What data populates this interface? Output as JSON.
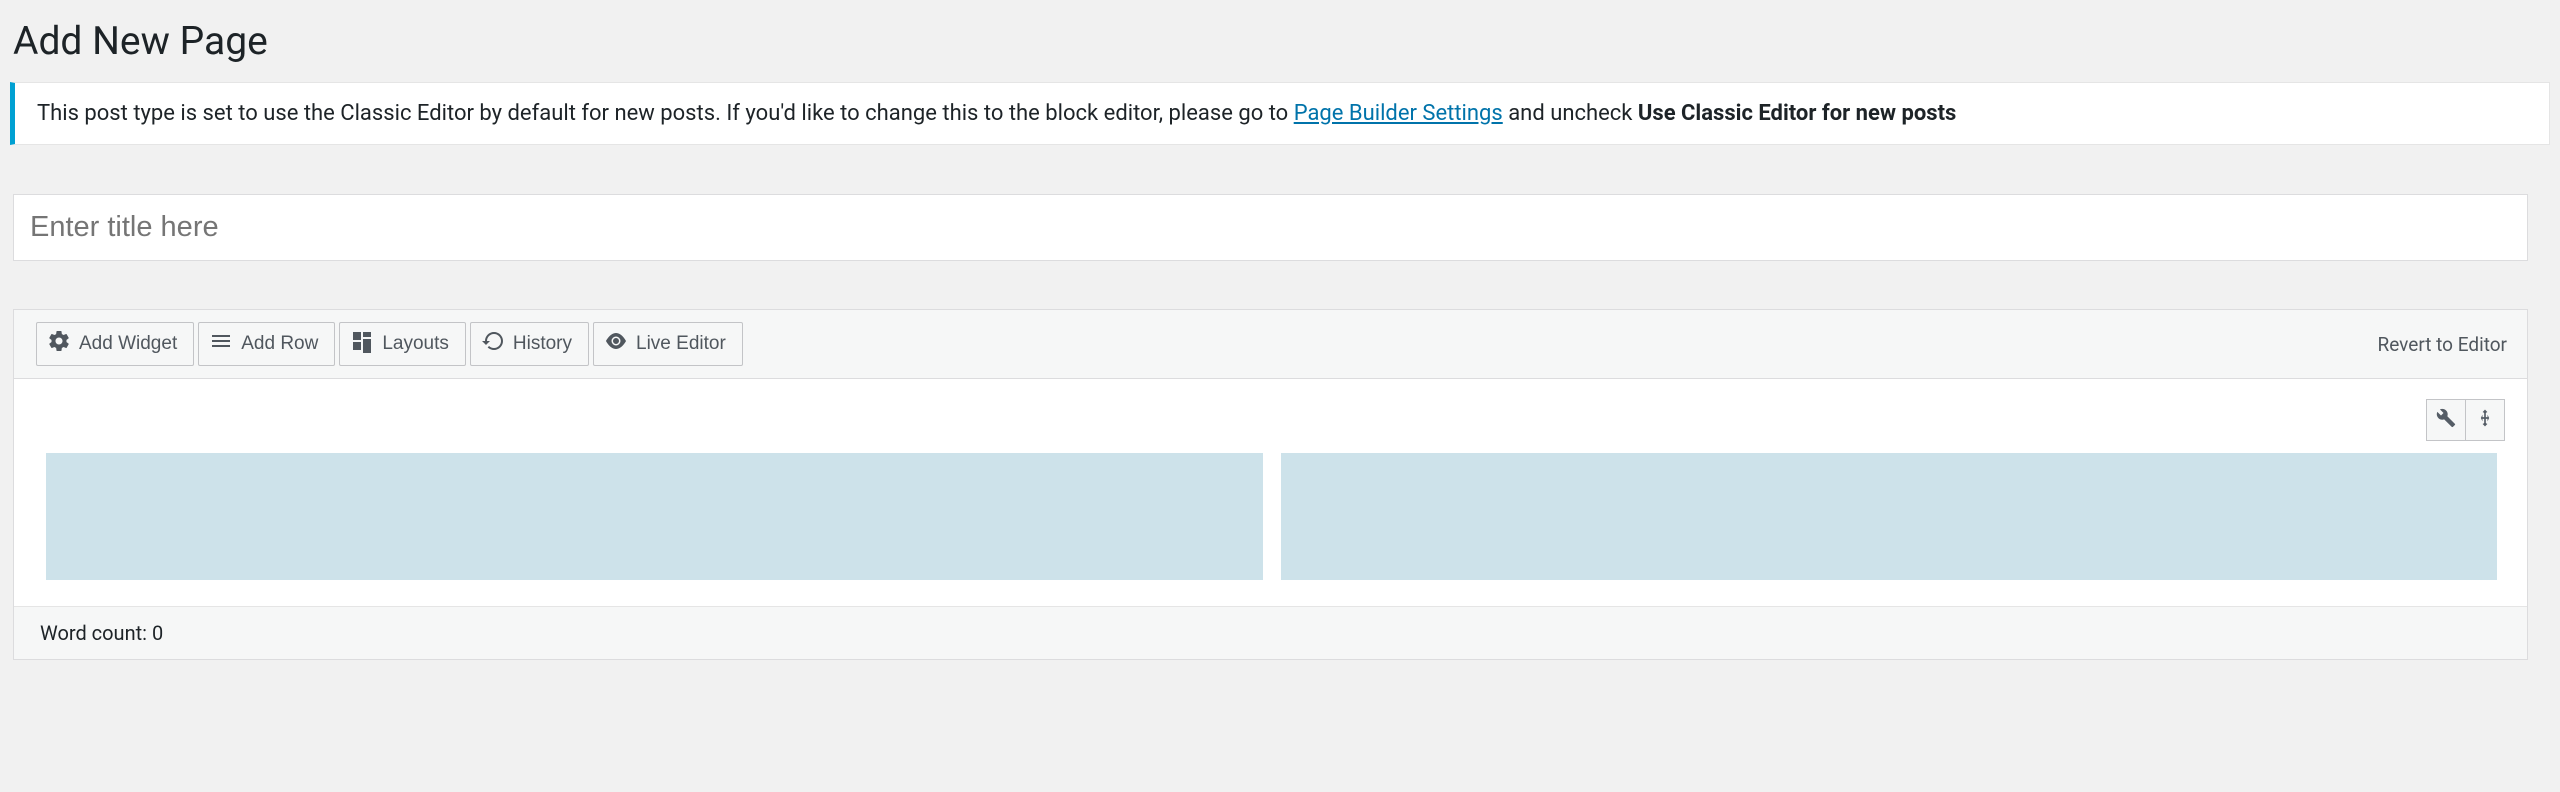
{
  "heading": "Add New Page",
  "notice": {
    "pre": "This post type is set to use the Classic Editor by default for new posts. If you'd like to change this to the block editor, please go to ",
    "link": "Page Builder Settings",
    "mid": " and uncheck ",
    "bold": "Use Classic Editor for new posts"
  },
  "title_placeholder": "Enter title here",
  "toolbar": {
    "add_widget": "Add Widget",
    "add_row": "Add Row",
    "layouts": "Layouts",
    "history": "History",
    "live_editor": "Live Editor",
    "revert": "Revert to Editor"
  },
  "statusbar": {
    "word_count_label": "Word count: ",
    "word_count_value": "0"
  }
}
